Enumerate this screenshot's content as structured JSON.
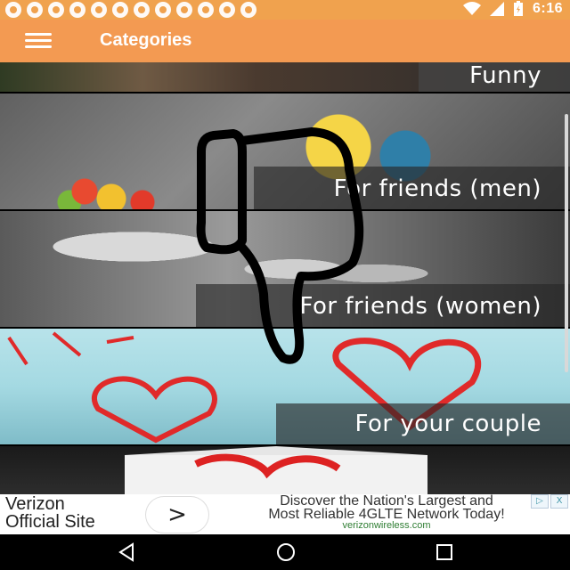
{
  "status_bar": {
    "time": "6:16",
    "icons": [
      "message-icon",
      "notification-icon",
      "ball-icon",
      "ball-icon",
      "ball-icon",
      "ball-icon",
      "ball-icon",
      "ball-icon",
      "ball-icon",
      "ball-icon",
      "ball-icon",
      "ball-icon"
    ],
    "right_icons": [
      "wifi-icon",
      "signal-icon",
      "battery-icon"
    ]
  },
  "app_bar": {
    "title": "Categories",
    "menu_icon": "hamburger-menu-icon"
  },
  "categories": [
    {
      "label": "Funny"
    },
    {
      "label": "For friends (men)"
    },
    {
      "label": "For friends (women)"
    },
    {
      "label": "For your couple"
    }
  ],
  "ad": {
    "left_line1": "Verizon",
    "left_line2": "Official Site",
    "headline_line1": "Discover the Nation's Largest and",
    "headline_line2": "Most Reliable 4GLTE Network Today!",
    "url": "verizonwireless.com",
    "arrow": ">",
    "controls": [
      "▷",
      "X"
    ]
  },
  "nav_bar": {
    "back": "back-icon",
    "home": "home-icon",
    "recent": "recent-apps-icon"
  },
  "colors": {
    "status_bar": "#f0a24e",
    "app_bar": "#f39a52",
    "label_bar": "#282828"
  }
}
